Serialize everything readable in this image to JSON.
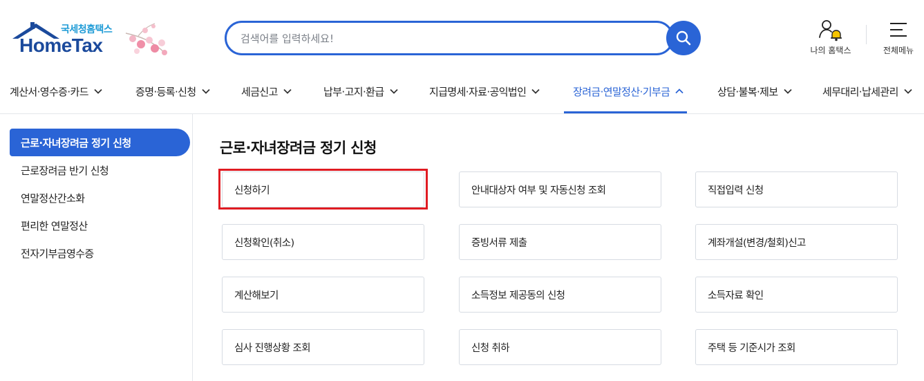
{
  "logo": {
    "korean": "국세청홈택스",
    "english": "HomeTax"
  },
  "search": {
    "placeholder": "검색어를 입력하세요!",
    "value": ""
  },
  "header_actions": {
    "my_hometax": "나의 홈택스",
    "all_menu": "전체메뉴"
  },
  "nav": {
    "items": [
      {
        "label": "계산서·영수증·카드",
        "expanded": false
      },
      {
        "label": "증명·등록·신청",
        "expanded": false
      },
      {
        "label": "세금신고",
        "expanded": false
      },
      {
        "label": "납부·고지·환급",
        "expanded": false
      },
      {
        "label": "지급명세·자료·공익법인",
        "expanded": false
      },
      {
        "label": "장려금·연말정산·기부금",
        "expanded": true
      },
      {
        "label": "상담·불복·제보",
        "expanded": false
      },
      {
        "label": "세무대리·납세관리",
        "expanded": false
      }
    ]
  },
  "sidebar": {
    "items": [
      {
        "label": "근로·자녀장려금 정기 신청",
        "active": true
      },
      {
        "label": "근로장려금 반기 신청",
        "active": false
      },
      {
        "label": "연말정산간소화",
        "active": false
      },
      {
        "label": "편리한 연말정산",
        "active": false
      },
      {
        "label": "전자기부금영수증",
        "active": false
      }
    ]
  },
  "main": {
    "title": "근로·자녀장려금 정기 신청",
    "cards": [
      "신청하기",
      "안내대상자 여부 및 자동신청 조회",
      "직접입력 신청",
      "신청확인(취소)",
      "증빙서류 제출",
      "계좌개설(변경/철회)신고",
      "계산해보기",
      "소득정보 제공동의 신청",
      "소득자료 확인",
      "심사 진행상황 조회",
      "신청 취하",
      "주택 등 기준시가 조회"
    ]
  },
  "colors": {
    "accent": "#2a64d6",
    "highlight": "#e01b22",
    "logo_blue": "#1b4a9c",
    "logo_teal": "#1e9bd6"
  },
  "icons": {
    "search": "search-icon",
    "user_bell": "user-bell-icon",
    "hamburger": "hamburger-menu-icon",
    "chevron_down": "chevron-down-icon",
    "chevron_up": "chevron-up-icon"
  }
}
